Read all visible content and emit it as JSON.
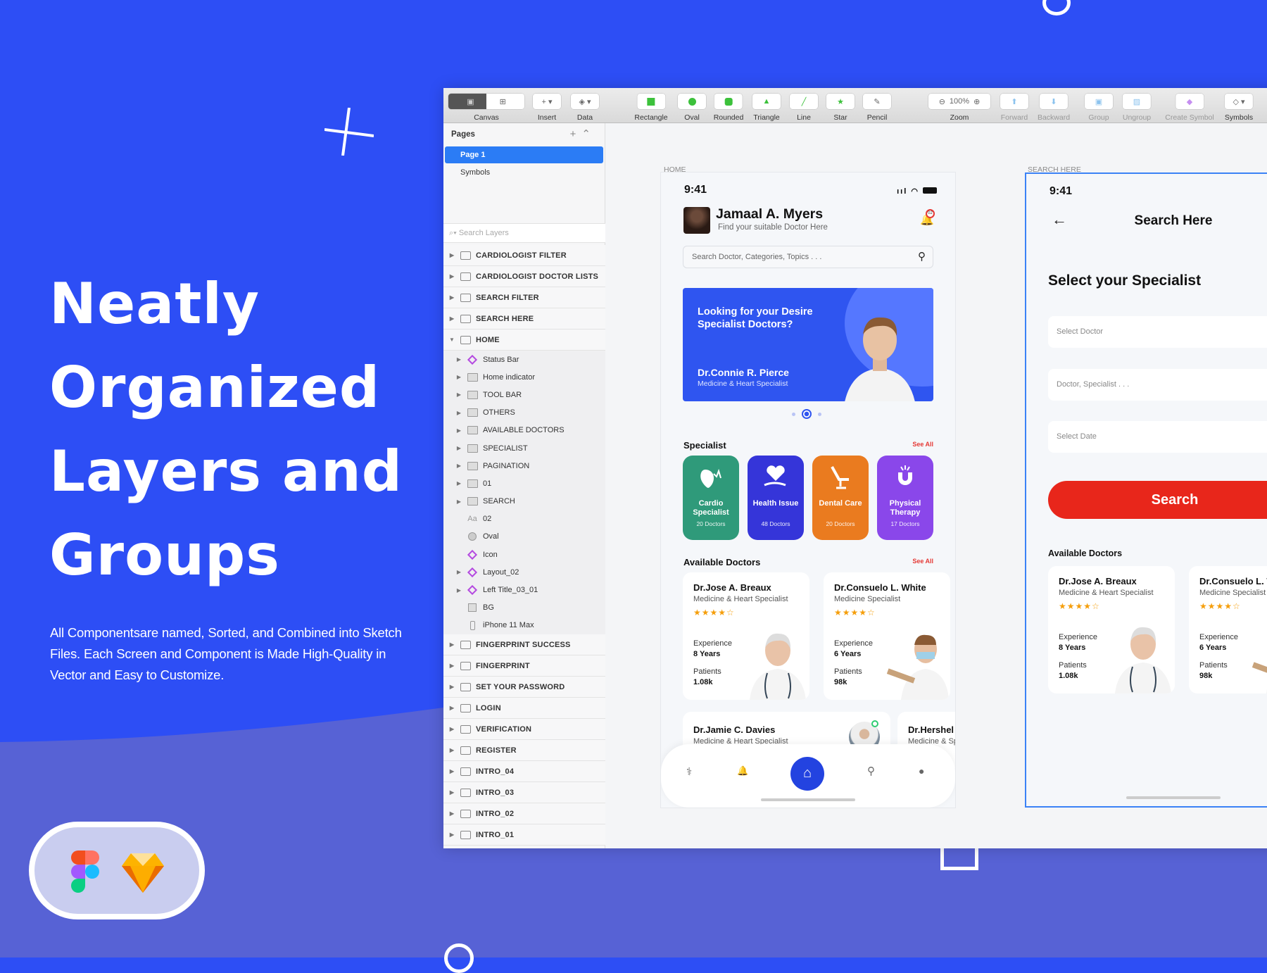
{
  "hero": {
    "title_lines": [
      "Neatly",
      "Organized",
      "Layers and",
      "Groups"
    ],
    "description": "All Componentsare named, Sorted, and Combined into Sketch Files. Each Screen and Component is Made High-Quality in Vector and Easy to Customize.",
    "badge_icons": [
      "figma-logo-icon",
      "sketch-logo-icon"
    ]
  },
  "colors": {
    "background": "#2d4ef5",
    "lower_background": "#5762d5",
    "accent": "#2b7cf5",
    "search_button": "#e8261b"
  },
  "toolbar": {
    "items": [
      {
        "label": "Canvas",
        "icon": "canvas-icon"
      },
      {
        "label": "Insert",
        "icon": "plus-icon"
      },
      {
        "label": "Data",
        "icon": "data-icon"
      },
      {
        "label": "Rectangle",
        "icon": "rectangle-icon"
      },
      {
        "label": "Oval",
        "icon": "oval-icon"
      },
      {
        "label": "Rounded",
        "icon": "rounded-icon"
      },
      {
        "label": "Triangle",
        "icon": "triangle-icon"
      },
      {
        "label": "Line",
        "icon": "line-icon"
      },
      {
        "label": "Star",
        "icon": "star-icon"
      },
      {
        "label": "Pencil",
        "icon": "pencil-icon"
      },
      {
        "label": "Zoom",
        "icon": "zoom-icon",
        "value": "100%"
      },
      {
        "label": "Forward",
        "icon": "forward-icon",
        "disabled": true
      },
      {
        "label": "Backward",
        "icon": "backward-icon",
        "disabled": true
      },
      {
        "label": "Group",
        "icon": "group-icon",
        "disabled": true
      },
      {
        "label": "Ungroup",
        "icon": "ungroup-icon",
        "disabled": true
      },
      {
        "label": "Create Symbol",
        "icon": "create-symbol-icon",
        "disabled": true
      },
      {
        "label": "Symbols",
        "icon": "symbols-icon"
      }
    ]
  },
  "sidebar": {
    "pages_title": "Pages",
    "pages": [
      {
        "label": "Page 1",
        "selected": true
      },
      {
        "label": "Symbols"
      }
    ],
    "search_placeholder": "Search Layers",
    "layers_top": [
      "CARDIOLOGIST FILTER",
      "CARDIOLOGIST DOCTOR LISTS",
      "SEARCH FILTER",
      "SEARCH HERE"
    ],
    "expanded": "HOME",
    "children": [
      {
        "label": "Status Bar",
        "type": "symbol",
        "arrow": true
      },
      {
        "label": "Home indicator",
        "type": "folder",
        "arrow": true
      },
      {
        "label": "TOOL BAR",
        "type": "folder",
        "arrow": true
      },
      {
        "label": "OTHERS",
        "type": "folder",
        "arrow": true
      },
      {
        "label": "AVAILABLE DOCTORS",
        "type": "folder",
        "arrow": true
      },
      {
        "label": "SPECIALIST",
        "type": "folder",
        "arrow": true
      },
      {
        "label": "PAGINATION",
        "type": "folder",
        "arrow": true
      },
      {
        "label": "01",
        "type": "folder",
        "arrow": true
      },
      {
        "label": "SEARCH",
        "type": "folder",
        "arrow": true
      },
      {
        "label": "02",
        "type": "text",
        "arrow": false
      },
      {
        "label": "Oval",
        "type": "oval",
        "arrow": false
      },
      {
        "label": "Icon",
        "type": "symbol",
        "arrow": false
      },
      {
        "label": "Layout_02",
        "type": "symbol",
        "arrow": true
      },
      {
        "label": "Left Title_03_01",
        "type": "symbol",
        "arrow": true
      },
      {
        "label": "BG",
        "type": "rect",
        "arrow": false
      },
      {
        "label": "iPhone 11 Max",
        "type": "phone",
        "arrow": false
      }
    ],
    "text_icon_glyph": "Aa",
    "layers_bottom": [
      "FINGERPRINT SUCCESS",
      "FINGERPRINT",
      "SET YOUR PASSWORD",
      "LOGIN",
      "VERIFICATION",
      "REGISTER",
      "INTRO_04",
      "INTRO_03",
      "INTRO_02",
      "INTRO_01"
    ]
  },
  "home": {
    "artboard_label": "HOME",
    "time": "9:41",
    "user_name": "Jamaal A. Myers",
    "user_subtitle": "Find your suitable Doctor Here",
    "notification_count": "02",
    "search_placeholder": "Search Doctor, Categories, Topics . . .",
    "banner": {
      "headline": "Looking for your Desire Specialist Doctors?",
      "doctor": "Dr.Connie R. Pierce",
      "specialty": "Medicine & Heart Specialist"
    },
    "carousel": {
      "count": 3,
      "active": 2
    },
    "specialist_title": "Specialist",
    "see_all": "See All",
    "specialists": [
      {
        "name": "Cardio Specialist",
        "count": "20 Doctors",
        "color": "#2f9a7a",
        "icon": "heart-organ-icon"
      },
      {
        "name": "Health Issue",
        "count": "48 Doctors",
        "color": "#3535d9",
        "icon": "heart-hand-icon"
      },
      {
        "name": "Dental Care",
        "count": "20 Doctors",
        "color": "#ea7b1f",
        "icon": "dental-chair-icon"
      },
      {
        "name": "Physical Therapy",
        "count": "17 Doctors",
        "color": "#8a47ea",
        "icon": "magnet-icon"
      }
    ],
    "doctors_title": "Available Doctors",
    "doctors": [
      {
        "name": "Dr.Jose A. Breaux",
        "specialty": "Medicine & Heart Specialist",
        "rating": 4,
        "experience_label": "Experience",
        "experience": "8 Years",
        "patients_label": "Patients",
        "patients": "1.08k"
      },
      {
        "name": "Dr.Consuelo L. White",
        "specialty": "Medicine Specialist",
        "rating": 4,
        "experience_label": "Experience",
        "experience": "6 Years",
        "patients_label": "Patients",
        "patients": "98k"
      }
    ],
    "doctors_row2": [
      {
        "name": "Dr.Jamie C. Davies",
        "specialty": "Medicine & Heart Specialist"
      },
      {
        "name": "Dr.Hershel",
        "specialty": "Medicine & Sp"
      }
    ],
    "nav": [
      "caduceus-icon",
      "bell-icon",
      "home-icon",
      "search-icon",
      "user-icon"
    ],
    "nav_active": "home-icon"
  },
  "search_screen": {
    "artboard_label": "SEARCH HERE",
    "time": "9:41",
    "title": "Search Here",
    "heading": "Select your Specialist",
    "fields": [
      "Select Doctor",
      "Doctor, Specialist . . .",
      "Select Date"
    ],
    "button": "Search",
    "doctors_title": "Available Doctors"
  }
}
